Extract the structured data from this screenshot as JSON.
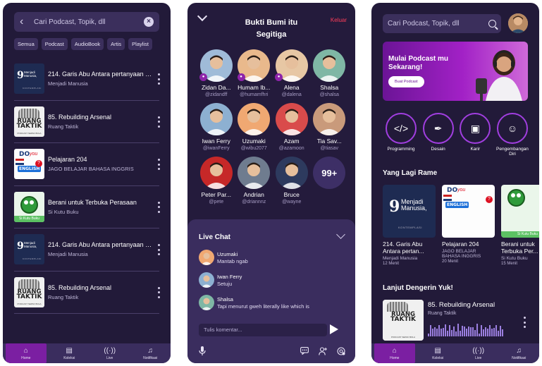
{
  "screen1": {
    "search_placeholder": "Cari Podcast, Topik, dll",
    "chips": [
      "Semua",
      "Podcast",
      "AudioBook",
      "Artis",
      "Playlist"
    ],
    "results": [
      {
        "title": "214. Garis Abu Antara pertanyaan dan pernyataan",
        "author": "Menjadi Manusia",
        "art": "mm"
      },
      {
        "title": "85. Rebuilding Arsenal",
        "author": "Ruang Taktik",
        "art": "rt"
      },
      {
        "title": "Pelajaran 204",
        "author": "JAGO BELAJAR BAHASA INGGRIS",
        "art": "en"
      },
      {
        "title": "Berani untuk Terbuka Perasaan",
        "author": "Si Kutu Buku",
        "art": "kb"
      },
      {
        "title": "214. Garis Abu Antara pertanyaan dan pernyataan",
        "author": "Menjadi Manusia",
        "art": "mm"
      },
      {
        "title": "85. Rebuilding Arsenal",
        "author": "Ruang Taktik",
        "art": "rt"
      }
    ]
  },
  "art": {
    "mm_logo": "9",
    "mm_title": "Menjadi Manusia,",
    "mm_kicker": "KONTEMPLASI",
    "rt_line1": "RUANG",
    "rt_line2": "TAKTIK",
    "rt_tag": "PODCAST SEPAK BOLA",
    "en_do": "DO",
    "en_you": "you",
    "en_word": "ENGLISH",
    "en_q": "?",
    "kb_name": "Si Kutu Buku"
  },
  "nav": [
    {
      "label": "Home",
      "icon": "home-icon",
      "glyph": "⌂"
    },
    {
      "label": "Koleksi",
      "icon": "collection-icon",
      "glyph": "▤"
    },
    {
      "label": "Live",
      "icon": "live-icon",
      "glyph": "((·))"
    },
    {
      "label": "Notifikasi",
      "icon": "bell-icon",
      "glyph": "♫"
    }
  ],
  "screen2": {
    "title": "Bukti Bumi itu Segitiga",
    "exit_label": "Keluar",
    "speakers": [
      {
        "name": "Zidan Da...",
        "handle": "@zidandff",
        "mic": true,
        "color": "#9fbbd8"
      },
      {
        "name": "Humam Ib...",
        "handle": "@humamfhri",
        "mic": true,
        "color": "#e9b98c"
      },
      {
        "name": "Alena",
        "handle": "@dalena",
        "mic": true,
        "color": "#e7c7a4"
      },
      {
        "name": "Shalsa",
        "handle": "@shalsa",
        "mic": false,
        "color": "#7fb7a5"
      },
      {
        "name": "Iwan Ferry",
        "handle": "@iwanFerry",
        "mic": false,
        "color": "#8db0d1"
      },
      {
        "name": "Uzumaki",
        "handle": "@wibu2077",
        "mic": false,
        "color": "#f0a872"
      },
      {
        "name": "Azam",
        "handle": "@azamoon",
        "mic": false,
        "color": "#d94b4b"
      },
      {
        "name": "Tia Sav...",
        "handle": "@tiasav",
        "mic": false,
        "color": "#c99a7b"
      },
      {
        "name": "Peter Par...",
        "handle": "@pete",
        "mic": false,
        "color": "#c62828"
      },
      {
        "name": "Andrian",
        "handle": "@driannnz",
        "mic": false,
        "color": "#6f7c8f"
      },
      {
        "name": "Bruce",
        "handle": "@wayne",
        "mic": false,
        "color": "#2d3a5e"
      }
    ],
    "more_count": "99+",
    "chat": {
      "title": "Live Chat",
      "messages": [
        {
          "name": "Uzumaki",
          "text": "Mantab ngab",
          "color": "#f0a872"
        },
        {
          "name": "Iwan Ferry",
          "text": "Setuju",
          "color": "#8db0d1"
        },
        {
          "name": "Shalsa",
          "text": "Tapi menurut gweh literally like which is",
          "color": "#7fb7a5"
        }
      ],
      "input_placeholder": "Tulis komentar...",
      "icons": [
        "microphone-icon",
        "chat-icon",
        "add-user-icon",
        "settings-icon"
      ]
    }
  },
  "screen3": {
    "search_placeholder": "Cari Podcast, Topik, dll",
    "banner": {
      "title": "Mulai Podcast mu Sekarang!",
      "button": "Buat Podcast"
    },
    "categories": [
      {
        "label": "Programming",
        "glyph": "</>",
        "icon": "code-icon"
      },
      {
        "label": "Desain",
        "glyph": "✒",
        "icon": "pen-icon"
      },
      {
        "label": "Karir",
        "glyph": "▣",
        "icon": "briefcase-icon"
      },
      {
        "label": "Pengembangan Diri",
        "glyph": "☺",
        "icon": "head-icon"
      }
    ],
    "trending_title": "Yang Lagi Rame",
    "trending": [
      {
        "title": "214. Garis Abu Antara pertan...",
        "author": "Menjadi Manusia",
        "duration": "12 Menit",
        "art": "mm"
      },
      {
        "title": "Pelajaran 204",
        "author": "JAGO BELAJAR BAHASA INGGRIS",
        "duration": "20 Menit",
        "art": "en"
      },
      {
        "title": "Berani untuk Terbuka Per...",
        "author": "Si Kutu Buku",
        "duration": "15 Menit",
        "art": "kb"
      }
    ],
    "continue_title": "Lanjut Dengerin Yuk!",
    "continue": {
      "title": "85. Rebuilding Arsenal",
      "author": "Ruang Taktik"
    }
  }
}
